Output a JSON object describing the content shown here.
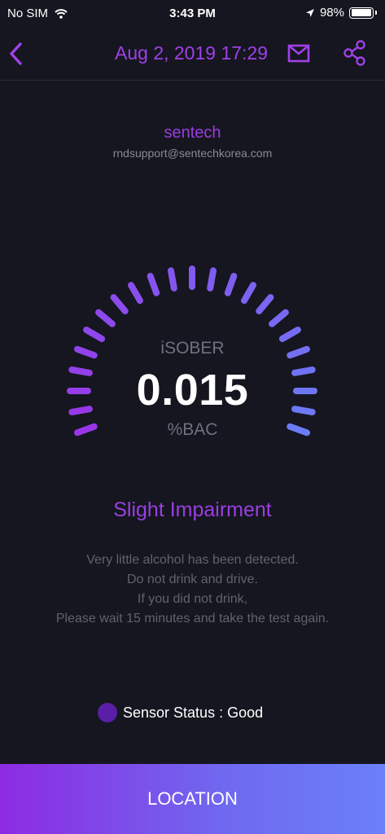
{
  "status_bar": {
    "carrier": "No SIM",
    "time": "3:43 PM",
    "battery": "98%",
    "battery_level": 0.98,
    "icons": [
      "wifi-icon",
      "location-arrow-icon",
      "battery-icon"
    ]
  },
  "nav": {
    "title": "Aug 2, 2019 17:29",
    "icons": [
      "chevron-left-icon",
      "mail-icon",
      "share-icon"
    ]
  },
  "user": {
    "name": "sentech",
    "email": "rndsupport@sentechkorea.com"
  },
  "reading": {
    "device": "iSOBER",
    "value": "0.015",
    "unit": "%BAC"
  },
  "result": {
    "title": "Slight Impairment",
    "lines": [
      "Very little alcohol has been detected.",
      "Do not drink and drive.",
      "If you did not drink,",
      "Please wait 15 minutes and take the test again."
    ]
  },
  "sensor": {
    "label": "Sensor Status : Good"
  },
  "location_button": "LOCATION",
  "colors": {
    "accent": "#9a3ee0",
    "background": "#15161f",
    "gauge_start": "#9a36e8",
    "gauge_end": "#6b7cf6",
    "button_start": "#8d2be2",
    "button_end": "#6a80f8"
  }
}
